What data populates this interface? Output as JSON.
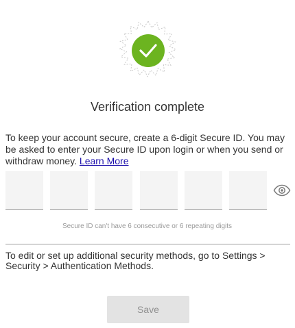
{
  "title": "Verification complete",
  "intro": {
    "text": "To keep your account secure, create a 6-digit Secure ID. You may be asked to enter your Secure ID upon login or when you send or withdraw money.",
    "learn_more": "Learn More"
  },
  "pin": {
    "digits": [
      "",
      "",
      "",
      "",
      "",
      ""
    ]
  },
  "hint": "Secure ID can't have 6 consecutive or 6 repeating digits",
  "settings_note": "To edit or set up additional security methods, go to Settings > Security > Authentication Methods.",
  "save_label": "Save",
  "icons": {
    "badge": "check-icon",
    "reveal": "eye-icon"
  },
  "colors": {
    "success": "#6cb420",
    "link": "#1a0dab",
    "button_bg": "#e3e3e3",
    "button_text": "#8f8f8f"
  }
}
